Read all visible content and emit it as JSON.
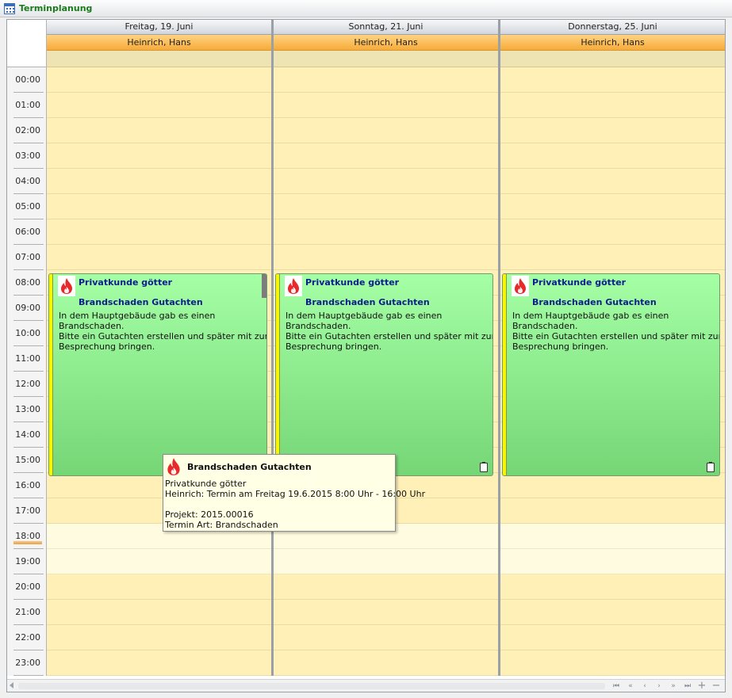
{
  "window": {
    "title": "Terminplanung"
  },
  "hours": [
    "00:00",
    "01:00",
    "02:00",
    "03:00",
    "04:00",
    "05:00",
    "06:00",
    "07:00",
    "08:00",
    "09:00",
    "10:00",
    "11:00",
    "12:00",
    "13:00",
    "14:00",
    "15:00",
    "16:00",
    "17:00",
    "18:00",
    "19:00",
    "20:00",
    "21:00",
    "22:00",
    "23:00"
  ],
  "days": [
    {
      "date": "Freitag, 19. Juni",
      "resource": "Heinrich, Hans"
    },
    {
      "date": "Sonntag, 21. Juni",
      "resource": "Heinrich, Hans"
    },
    {
      "date": "Donnerstag, 25. Juni",
      "resource": "Heinrich, Hans"
    }
  ],
  "appointment": {
    "client": "Privatkunde götter",
    "subject": "Brandschaden Gutachten",
    "body": [
      "In dem Hauptgebäude gab es einen",
      "Brandschaden.",
      "Bitte ein Gutachten erstellen und später mit zur",
      "Besprechung bringen."
    ],
    "icon": "fire-icon",
    "color": "#90f090",
    "status_color": "#f5f50a"
  },
  "tooltip": {
    "title": "Brandschaden Gutachten",
    "client": "Privatkunde götter",
    "termin": "Heinrich: Termin am Freitag 19.6.2015 8:00 Uhr - 16:00 Uhr",
    "projekt": "Projekt: 2015.00016",
    "art": "Termin Art: Brandschaden"
  },
  "nav": {
    "first": "⏮",
    "prev_page": "«",
    "prev": "‹",
    "next": "›",
    "next_page": "»",
    "last": "⏭",
    "add": "+",
    "remove": "−"
  }
}
